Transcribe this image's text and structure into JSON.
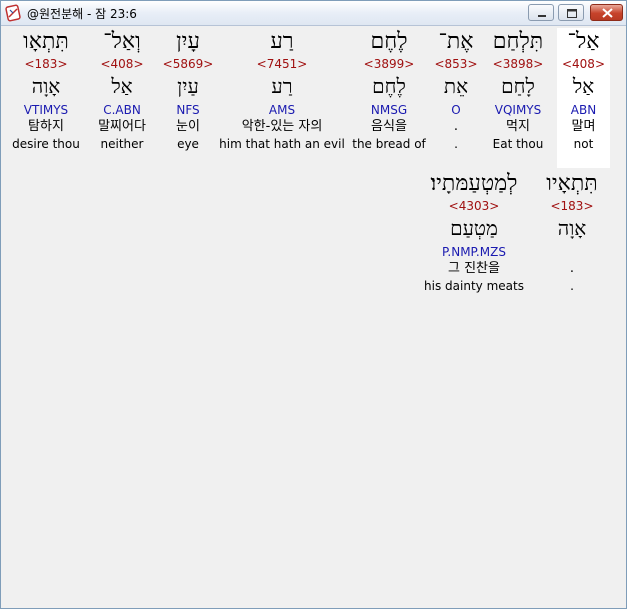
{
  "window": {
    "title": "@원전분해 - 잠 23:6"
  },
  "row1": [
    {
      "hebrew": "אַל־",
      "strong": "<408>",
      "lemma": "אַל",
      "morph": "ABN",
      "korean": "말며",
      "english": "not"
    },
    {
      "hebrew": "תִּלְחַם",
      "strong": "<3898>",
      "lemma": "לָחַם",
      "morph": "VQIMYS",
      "korean": "먹지",
      "english": "Eat thou"
    },
    {
      "hebrew": "אֶת־",
      "strong": "<853>",
      "lemma": "אֵת",
      "morph": "O",
      "korean": ".",
      "english": "."
    },
    {
      "hebrew": "לֶחֶם",
      "strong": "<3899>",
      "lemma": "לֶחֶם",
      "morph": "NMSG",
      "korean": "음식을",
      "english": "the bread of"
    },
    {
      "hebrew": "רַע",
      "strong": "<7451>",
      "lemma": "רַע",
      "morph": "AMS",
      "korean": "악한-있는 자의",
      "english": "him that hath an evil"
    },
    {
      "hebrew": "עָיִן",
      "strong": "<5869>",
      "lemma": "עַיִן",
      "morph": "NFS",
      "korean": "눈이",
      "english": "eye"
    },
    {
      "hebrew": "וְאַל־",
      "strong": "<408>",
      "lemma": "אַל",
      "morph": "C.ABN",
      "korean": "말찌어다",
      "english": "neither"
    },
    {
      "hebrew": "תִּתְאָו",
      "strong": "<183>",
      "lemma": "אָוָה",
      "morph": "VTIMYS",
      "korean": "탐하지",
      "english": "desire thou"
    }
  ],
  "row2": [
    {
      "hebrew": "תִּתְאָיו",
      "strong": "<183>",
      "lemma": "אָוָה",
      "morph": "",
      "korean": ".",
      "english": "."
    },
    {
      "hebrew": "לְמַטְעַמּתָיו׃",
      "strong": "<4303>",
      "lemma": "מַטְעַם",
      "morph": "P.NMP.MZS",
      "korean": "그 진찬을",
      "english": "his dainty meats"
    }
  ],
  "colors": {
    "strong": "#a01010",
    "morph": "#1a1ab0",
    "highlight": "#ffffff",
    "background": "#f0f0f0"
  },
  "icons": {
    "app": "bible-book-icon",
    "minimize": "minimize-icon",
    "maximize": "maximize-icon",
    "close": "close-icon"
  }
}
